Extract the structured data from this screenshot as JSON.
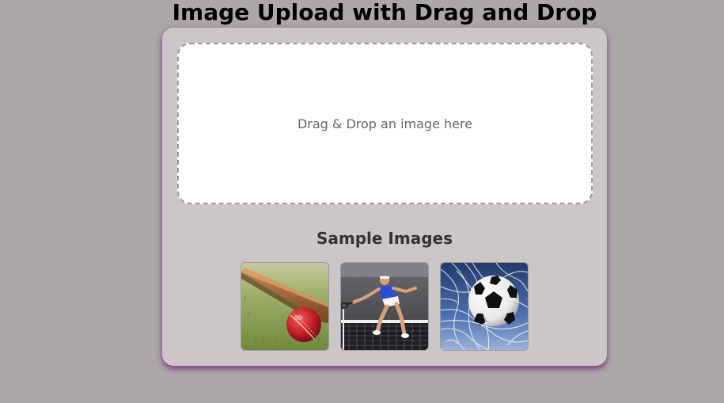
{
  "page": {
    "title": "Image Upload with Drag and Drop"
  },
  "drop_zone": {
    "text": "Drag & Drop an image here"
  },
  "samples": {
    "heading": "Sample Images",
    "images": [
      {
        "icon": "cricket-image"
      },
      {
        "icon": "tennis-image"
      },
      {
        "icon": "soccer-image"
      }
    ]
  },
  "colors": {
    "background": "#aca8a7",
    "card": "#cdc6c9",
    "card_shadow": "#803282",
    "drop_zone": "#ffffff",
    "drop_border": "#9a9a9a"
  }
}
